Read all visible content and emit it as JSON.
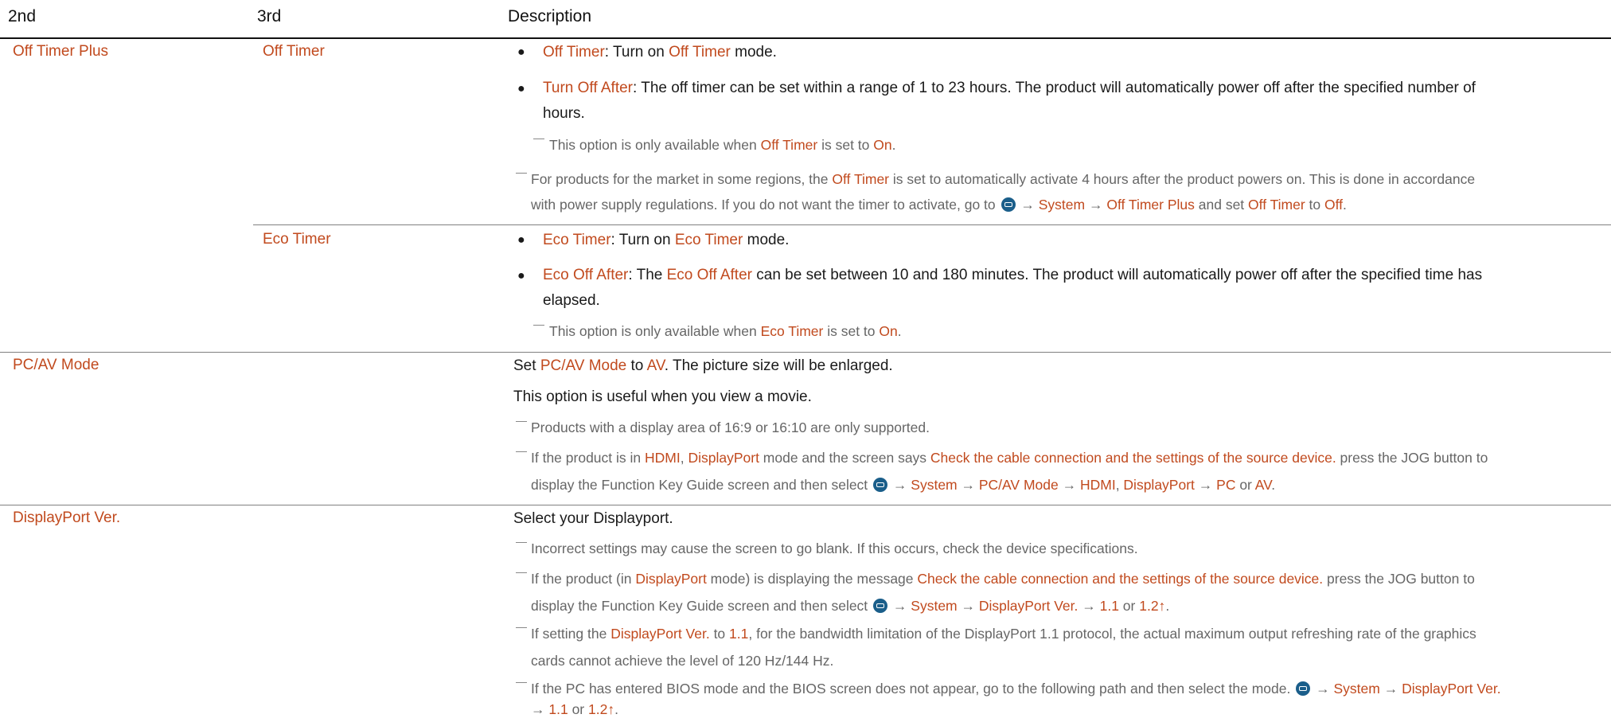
{
  "header": {
    "col2": "2nd",
    "col3": "3rd",
    "col4": "Description"
  },
  "colors": {
    "accent": "#c14a1e",
    "text": "#1a1a1a",
    "note": "#666666",
    "icon": "#1a5e8a"
  },
  "rows": {
    "off_timer_plus": {
      "label": "Off Timer Plus",
      "off_timer": {
        "label": "Off Timer",
        "b1": {
          "k": "Off Timer",
          "t1": ": Turn on ",
          "k2": "Off Timer",
          "t2": " mode."
        },
        "b2": {
          "k": "Turn Off After",
          "t1": ": The off timer can be set within a range of 1 to 23 hours. The product will automatically power off after the specified number of",
          "t2": "hours."
        },
        "n1": {
          "t1": "This option is only available when ",
          "k": "Off Timer",
          "t2": " is set to ",
          "k2": "On",
          "t3": "."
        },
        "n2": {
          "t1": "For products for the market in some regions, the ",
          "k": "Off Timer",
          "t2": " is set to automatically activate 4 hours after the product powers on. This is done in accordance",
          "t3": "with power supply regulations. If you do not want the timer to activate, go to ",
          "a1": " → ",
          "k2": "System",
          "a2": " → ",
          "k3": "Off Timer Plus",
          "t4": " and set ",
          "k4": "Off Timer",
          "t5": " to ",
          "k5": "Off",
          "t6": "."
        }
      },
      "eco_timer": {
        "label": "Eco Timer",
        "b1": {
          "k": "Eco Timer",
          "t1": ": Turn on ",
          "k2": "Eco Timer",
          "t2": " mode."
        },
        "b2": {
          "k": "Eco Off After",
          "t1": ": The ",
          "k2": "Eco Off After",
          "t2": " can be set between 10 and 180 minutes. The product will automatically power off after the specified time has",
          "t3": "elapsed."
        },
        "n1": {
          "t1": "This option is only available when ",
          "k": "Eco Timer",
          "t2": " is set to ",
          "k2": "On",
          "t3": "."
        }
      }
    },
    "pcav": {
      "label": "PC/AV Mode",
      "l1": {
        "t1": "Set ",
        "k": "PC/AV Mode",
        "t2": " to ",
        "k2": "AV",
        "t3": ". The picture size will be enlarged."
      },
      "l2": "This option is useful when you view a movie.",
      "n1": "Products with a display area of 16:9 or 16:10 are only supported.",
      "n2": {
        "t1": "If the product is in ",
        "k": "HDMI",
        "t2": ", ",
        "k2": "DisplayPort",
        "t3": " mode and the screen says ",
        "k3": "Check the cable connection and the settings of the source device.",
        "t4": " press the JOG button to",
        "t5": "display the Function Key Guide screen and then select ",
        "a1": " → ",
        "k4": "System",
        "a2": " → ",
        "k5": "PC/AV Mode",
        "a3": " → ",
        "k6": "HDMI",
        "t6": ", ",
        "k7": "DisplayPort",
        "a4": " → ",
        "k8": "PC",
        "t7": " or ",
        "k9": "AV",
        "t8": "."
      }
    },
    "dp": {
      "label": "DisplayPort Ver.",
      "l1": "Select your Displayport.",
      "n1": "Incorrect settings may cause the screen to go blank. If this occurs, check the device specifications.",
      "n2": {
        "t1": "If the product (in ",
        "k": "DisplayPort",
        "t2": " mode) is displaying the message ",
        "k2": "Check the cable connection and the settings of the source device.",
        "t3": " press the JOG button to",
        "t4": "display the Function Key Guide screen and then select ",
        "a1": " → ",
        "k3": "System",
        "a2": " → ",
        "k4": "DisplayPort Ver.",
        "a3": " → ",
        "k5": "1.1",
        "t5": " or ",
        "k6": "1.2↑",
        "t6": "."
      },
      "n3": {
        "t1": "If setting the ",
        "k": "DisplayPort Ver.",
        "t2": " to ",
        "k2": "1.1",
        "t3": ", for the bandwidth limitation of the DisplayPort 1.1 protocol, the actual maximum output refreshing rate of the graphics",
        "t4": "cards cannot achieve the level of 120 Hz/144 Hz."
      },
      "n4": {
        "t1": "If the PC has entered BIOS mode and the BIOS screen does not appear, go to the following path and then select the mode. ",
        "a1": " → ",
        "k": "System",
        "a2": " → ",
        "k2": "DisplayPort Ver.",
        "a3": "→ ",
        "k3": "1.1",
        "t2": " or ",
        "k4": "1.2↑",
        "t3": "."
      }
    }
  }
}
